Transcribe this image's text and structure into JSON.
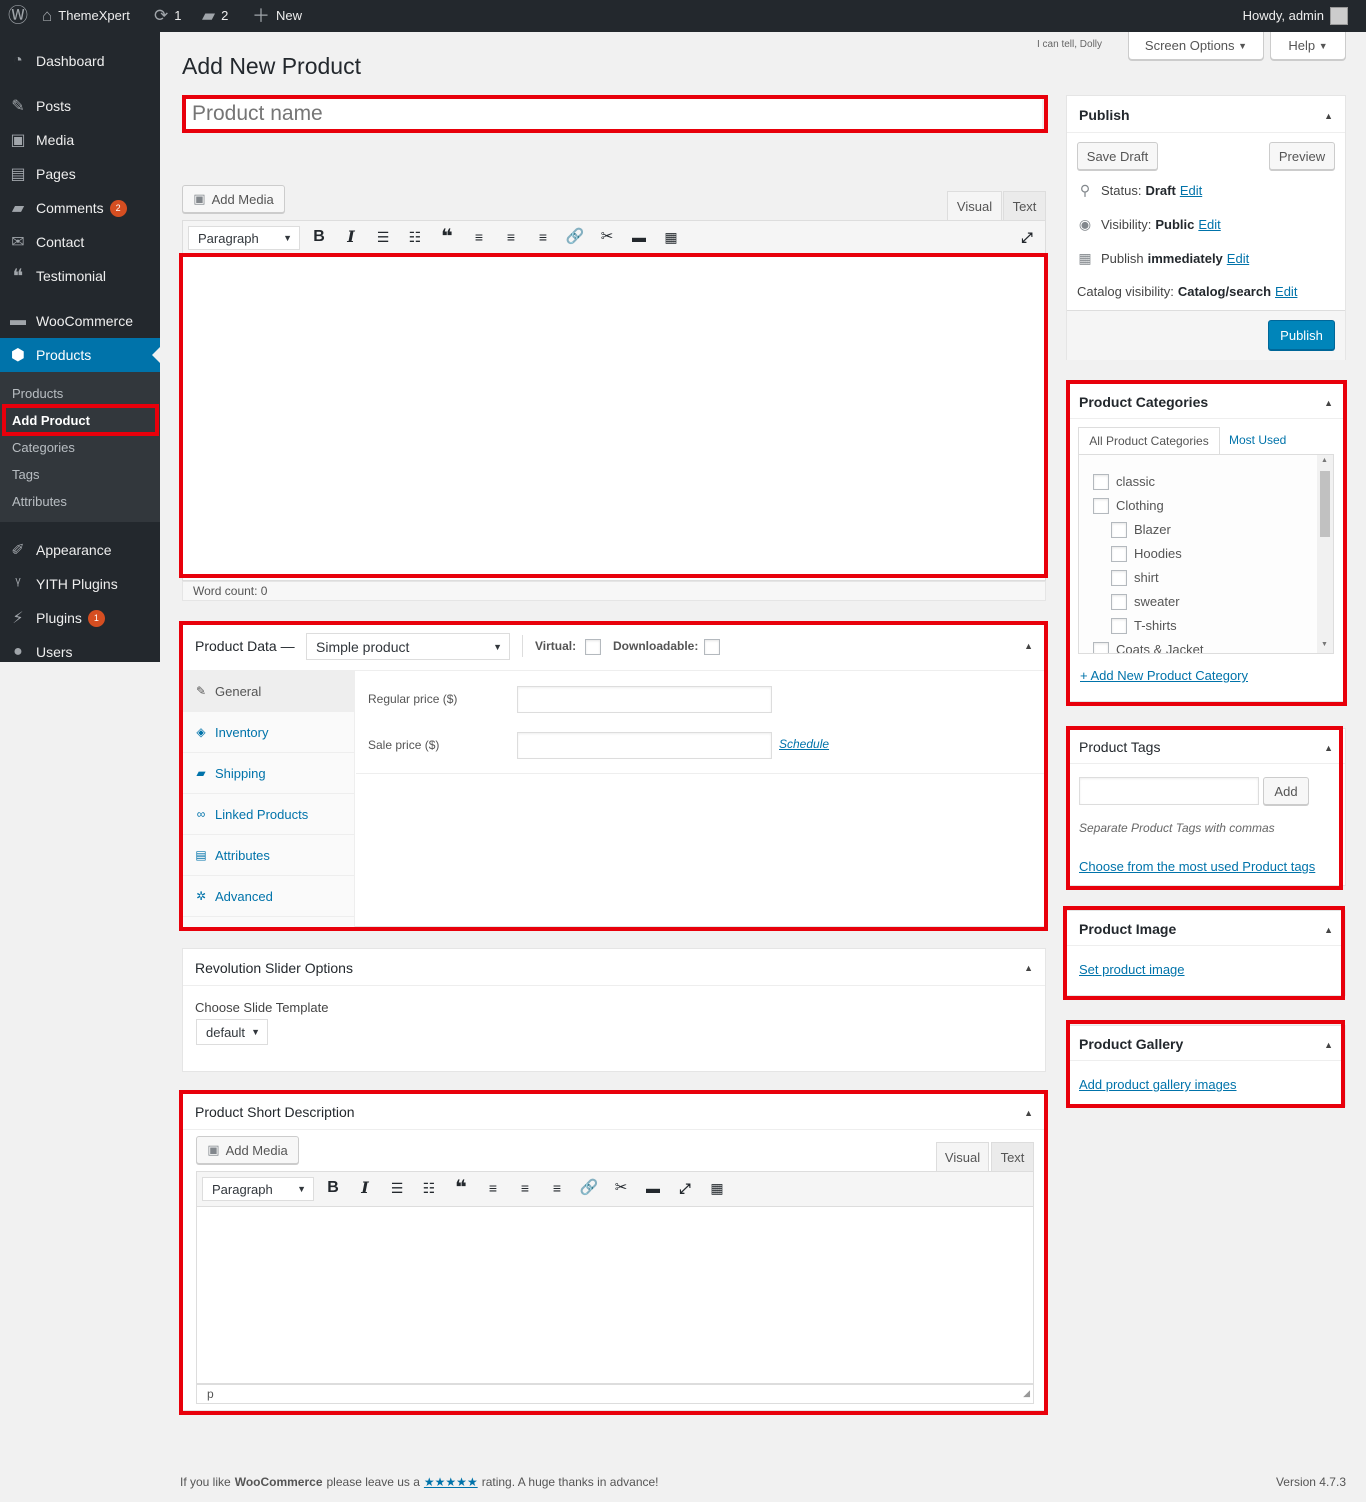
{
  "adminbar": {
    "site_name": "ThemeXpert",
    "updates_count": "1",
    "comments_count": "2",
    "new_label": "New",
    "howdy": "Howdy, admin"
  },
  "sidebar": {
    "items": [
      {
        "label": "Dashboard",
        "icon": "dashboard-icon"
      },
      {
        "label": "Posts",
        "icon": "pin-icon"
      },
      {
        "label": "Media",
        "icon": "media-icon"
      },
      {
        "label": "Pages",
        "icon": "page-icon"
      },
      {
        "label": "Comments",
        "icon": "comment-icon",
        "badge": "2"
      },
      {
        "label": "Contact",
        "icon": "mail-icon"
      },
      {
        "label": "Testimonial",
        "icon": "quote-icon"
      },
      {
        "label": "WooCommerce",
        "icon": "woo-icon"
      },
      {
        "label": "Products",
        "icon": "cube-icon"
      },
      {
        "label": "Appearance",
        "icon": "brush-icon"
      },
      {
        "label": "YITH Plugins",
        "icon": "yith-icon"
      },
      {
        "label": "Plugins",
        "icon": "plug-icon",
        "badge": "1"
      },
      {
        "label": "Users",
        "icon": "user-icon"
      }
    ],
    "submenu": [
      "Products",
      "Add Product",
      "Categories",
      "Tags",
      "Attributes"
    ]
  },
  "header": {
    "dolly": "I can tell, Dolly",
    "screen_options": "Screen Options",
    "help": "Help",
    "page_title": "Add New Product"
  },
  "title_input": {
    "placeholder": "Product name"
  },
  "editor": {
    "add_media": "Add Media",
    "tab_visual": "Visual",
    "tab_text": "Text",
    "format": "Paragraph",
    "word_count": "Word count: 0"
  },
  "product_data": {
    "title": "Product Data —",
    "type": "Simple product",
    "virtual_label": "Virtual:",
    "downloadable_label": "Downloadable:",
    "tabs": [
      "General",
      "Inventory",
      "Shipping",
      "Linked Products",
      "Attributes",
      "Advanced"
    ],
    "regular_price_label": "Regular price ($)",
    "sale_price_label": "Sale price ($)",
    "schedule": "Schedule"
  },
  "revslider": {
    "title": "Revolution Slider Options",
    "template_label": "Choose Slide Template",
    "template_value": "default"
  },
  "short_desc": {
    "title": "Product Short Description",
    "add_media": "Add Media",
    "tab_visual": "Visual",
    "tab_text": "Text",
    "format": "Paragraph",
    "path": "p"
  },
  "publish": {
    "title": "Publish",
    "save_draft": "Save Draft",
    "preview": "Preview",
    "status_label": "Status:",
    "status_value": "Draft",
    "visibility_label": "Visibility:",
    "visibility_value": "Public",
    "publish_label": "Publish",
    "publish_value": "immediately",
    "catalog_label": "Catalog visibility:",
    "catalog_value": "Catalog/search",
    "edit": "Edit",
    "publish_button": "Publish"
  },
  "categories": {
    "title": "Product Categories",
    "tab_all": "All Product Categories",
    "tab_most_used": "Most Used",
    "items": [
      "classic",
      "Clothing",
      "Blazer",
      "Hoodies",
      "shirt",
      "sweater",
      "T-shirts",
      "Coats & Jacket"
    ],
    "add_new": "+ Add New Product Category"
  },
  "tags": {
    "title": "Product Tags",
    "add": "Add",
    "hint": "Separate Product Tags with commas",
    "choose": "Choose from the most used Product tags"
  },
  "image": {
    "title": "Product Image",
    "link": "Set product image"
  },
  "gallery": {
    "title": "Product Gallery",
    "link": "Add product gallery images"
  },
  "footer": {
    "prefix": "If you like",
    "brand": "WooCommerce",
    "middle": "please leave us a",
    "stars": "★★★★★",
    "suffix": "rating. A huge thanks in advance!",
    "version": "Version 4.7.3"
  }
}
